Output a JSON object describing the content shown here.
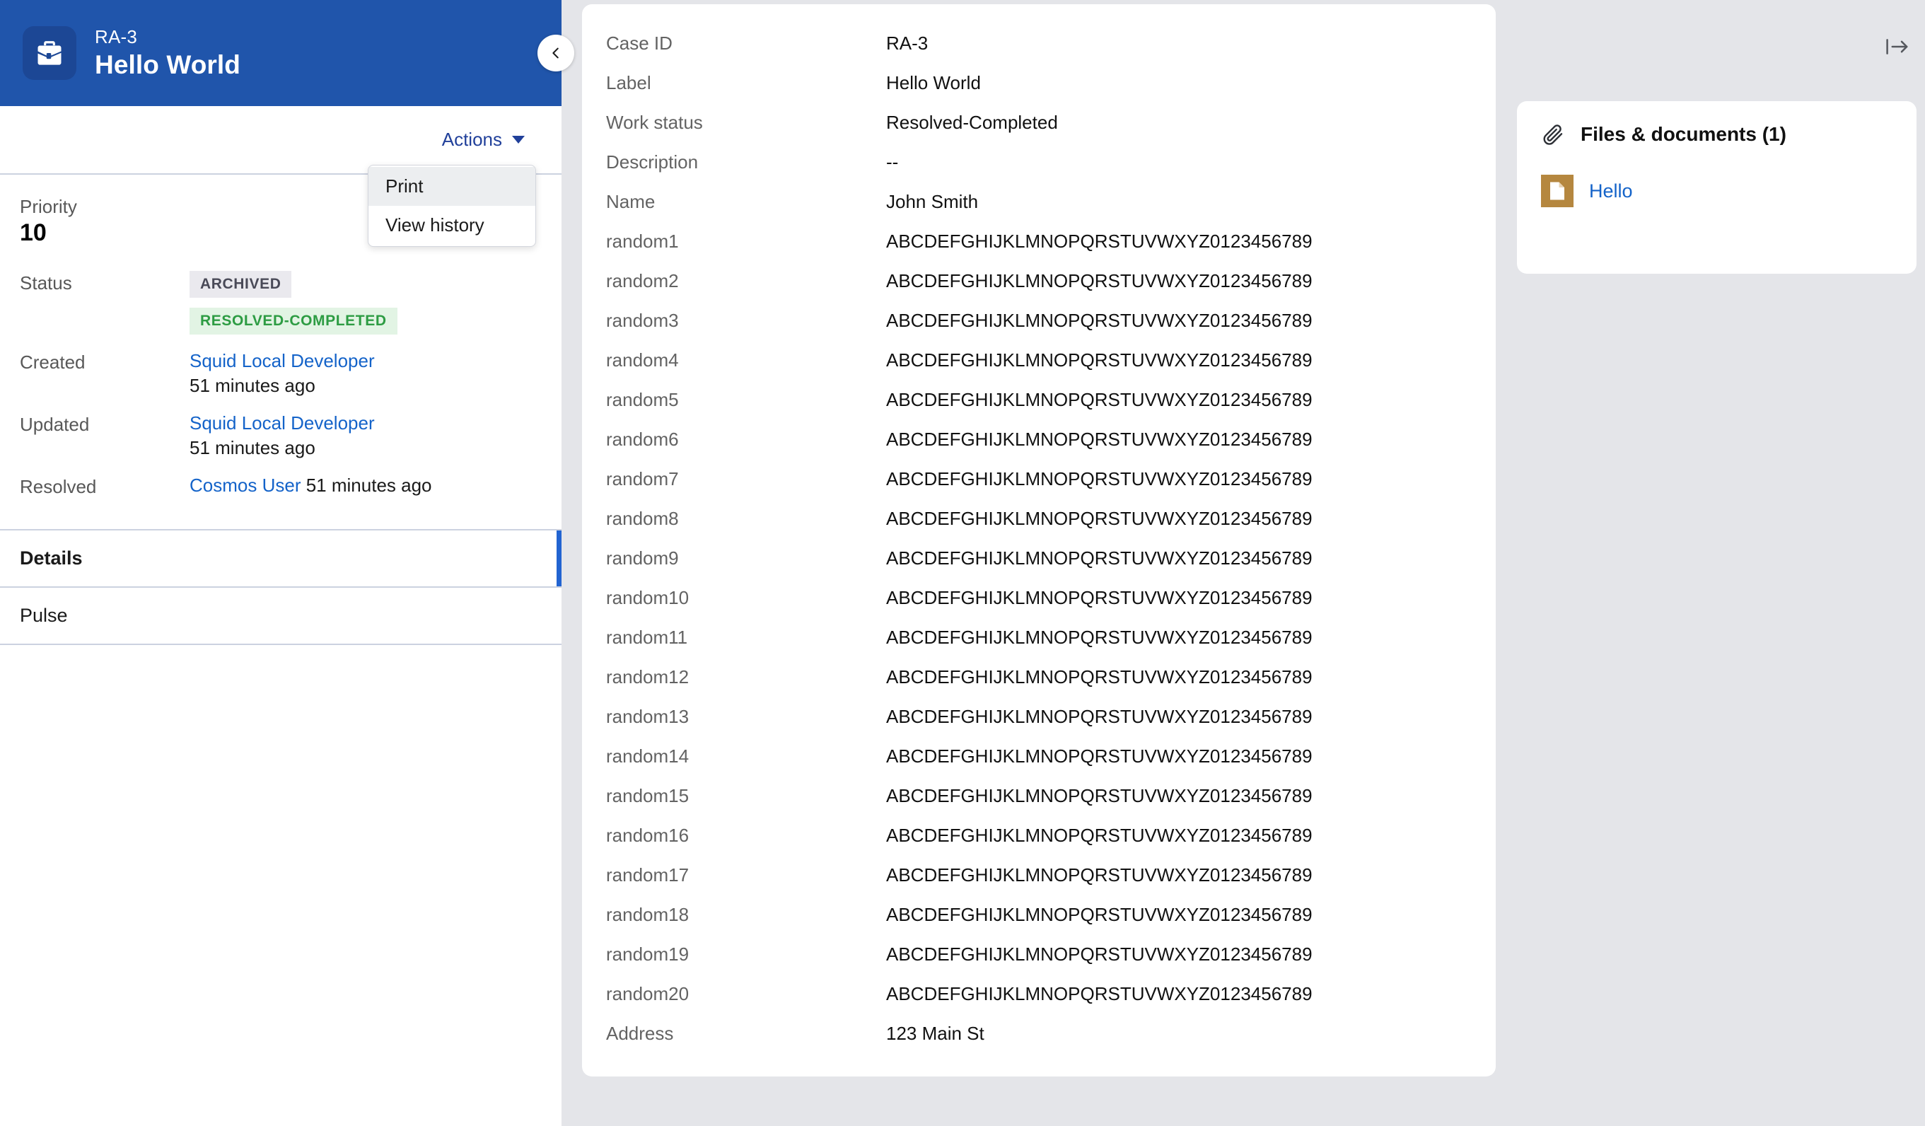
{
  "header": {
    "case_id": "RA-3",
    "title": "Hello World",
    "icon": "briefcase-icon",
    "accent_color": "#2055ab",
    "tile_color": "#1c4795"
  },
  "collapse_left": {
    "icon": "chevron-left-icon"
  },
  "collapse_right": {
    "icon": "panel-collapse-right-icon"
  },
  "actions": {
    "label": "Actions",
    "menu_items": [
      {
        "label": "Print",
        "hovered": true
      },
      {
        "label": "View history",
        "hovered": false
      }
    ]
  },
  "sidebar": {
    "priority": {
      "label": "Priority",
      "value": "10"
    },
    "status": {
      "label": "Status",
      "badges": [
        {
          "text": "ARCHIVED",
          "bg": "#eae9ee",
          "color": "#4a4a58"
        },
        {
          "text": "RESOLVED-COMPLETED",
          "bg": "#e2f4e4",
          "color": "#2d9c43"
        }
      ]
    },
    "created": {
      "label": "Created",
      "user": "Squid Local Developer",
      "time": "51 minutes ago"
    },
    "updated": {
      "label": "Updated",
      "user": "Squid Local Developer",
      "time": "51 minutes ago"
    },
    "resolved": {
      "label": "Resolved",
      "user": "Cosmos User",
      "time": "51 minutes ago"
    },
    "tabs": [
      {
        "label": "Details",
        "active": true
      },
      {
        "label": "Pulse",
        "active": false
      }
    ]
  },
  "main": {
    "fields": [
      {
        "label": "Case ID",
        "value": "RA-3"
      },
      {
        "label": "Label",
        "value": "Hello World"
      },
      {
        "label": "Work status",
        "value": "Resolved-Completed"
      },
      {
        "label": "Description",
        "value": "--"
      },
      {
        "label": "Name",
        "value": "John Smith"
      },
      {
        "label": "random1",
        "value": "ABCDEFGHIJKLMNOPQRSTUVWXYZ0123456789"
      },
      {
        "label": "random2",
        "value": "ABCDEFGHIJKLMNOPQRSTUVWXYZ0123456789"
      },
      {
        "label": "random3",
        "value": "ABCDEFGHIJKLMNOPQRSTUVWXYZ0123456789"
      },
      {
        "label": "random4",
        "value": "ABCDEFGHIJKLMNOPQRSTUVWXYZ0123456789"
      },
      {
        "label": "random5",
        "value": "ABCDEFGHIJKLMNOPQRSTUVWXYZ0123456789"
      },
      {
        "label": "random6",
        "value": "ABCDEFGHIJKLMNOPQRSTUVWXYZ0123456789"
      },
      {
        "label": "random7",
        "value": "ABCDEFGHIJKLMNOPQRSTUVWXYZ0123456789"
      },
      {
        "label": "random8",
        "value": "ABCDEFGHIJKLMNOPQRSTUVWXYZ0123456789"
      },
      {
        "label": "random9",
        "value": "ABCDEFGHIJKLMNOPQRSTUVWXYZ0123456789"
      },
      {
        "label": "random10",
        "value": "ABCDEFGHIJKLMNOPQRSTUVWXYZ0123456789"
      },
      {
        "label": "random11",
        "value": "ABCDEFGHIJKLMNOPQRSTUVWXYZ0123456789"
      },
      {
        "label": "random12",
        "value": "ABCDEFGHIJKLMNOPQRSTUVWXYZ0123456789"
      },
      {
        "label": "random13",
        "value": "ABCDEFGHIJKLMNOPQRSTUVWXYZ0123456789"
      },
      {
        "label": "random14",
        "value": "ABCDEFGHIJKLMNOPQRSTUVWXYZ0123456789"
      },
      {
        "label": "random15",
        "value": "ABCDEFGHIJKLMNOPQRSTUVWXYZ0123456789"
      },
      {
        "label": "random16",
        "value": "ABCDEFGHIJKLMNOPQRSTUVWXYZ0123456789"
      },
      {
        "label": "random17",
        "value": "ABCDEFGHIJKLMNOPQRSTUVWXYZ0123456789"
      },
      {
        "label": "random18",
        "value": "ABCDEFGHIJKLMNOPQRSTUVWXYZ0123456789"
      },
      {
        "label": "random19",
        "value": "ABCDEFGHIJKLMNOPQRSTUVWXYZ0123456789"
      },
      {
        "label": "random20",
        "value": "ABCDEFGHIJKLMNOPQRSTUVWXYZ0123456789"
      },
      {
        "label": "Address",
        "value": "123 Main St"
      }
    ]
  },
  "files_panel": {
    "title": "Files & documents (1)",
    "icon": "paperclip-icon",
    "files": [
      {
        "name": "Hello",
        "icon": "document-icon",
        "thumb_color": "#b5873f"
      }
    ]
  }
}
